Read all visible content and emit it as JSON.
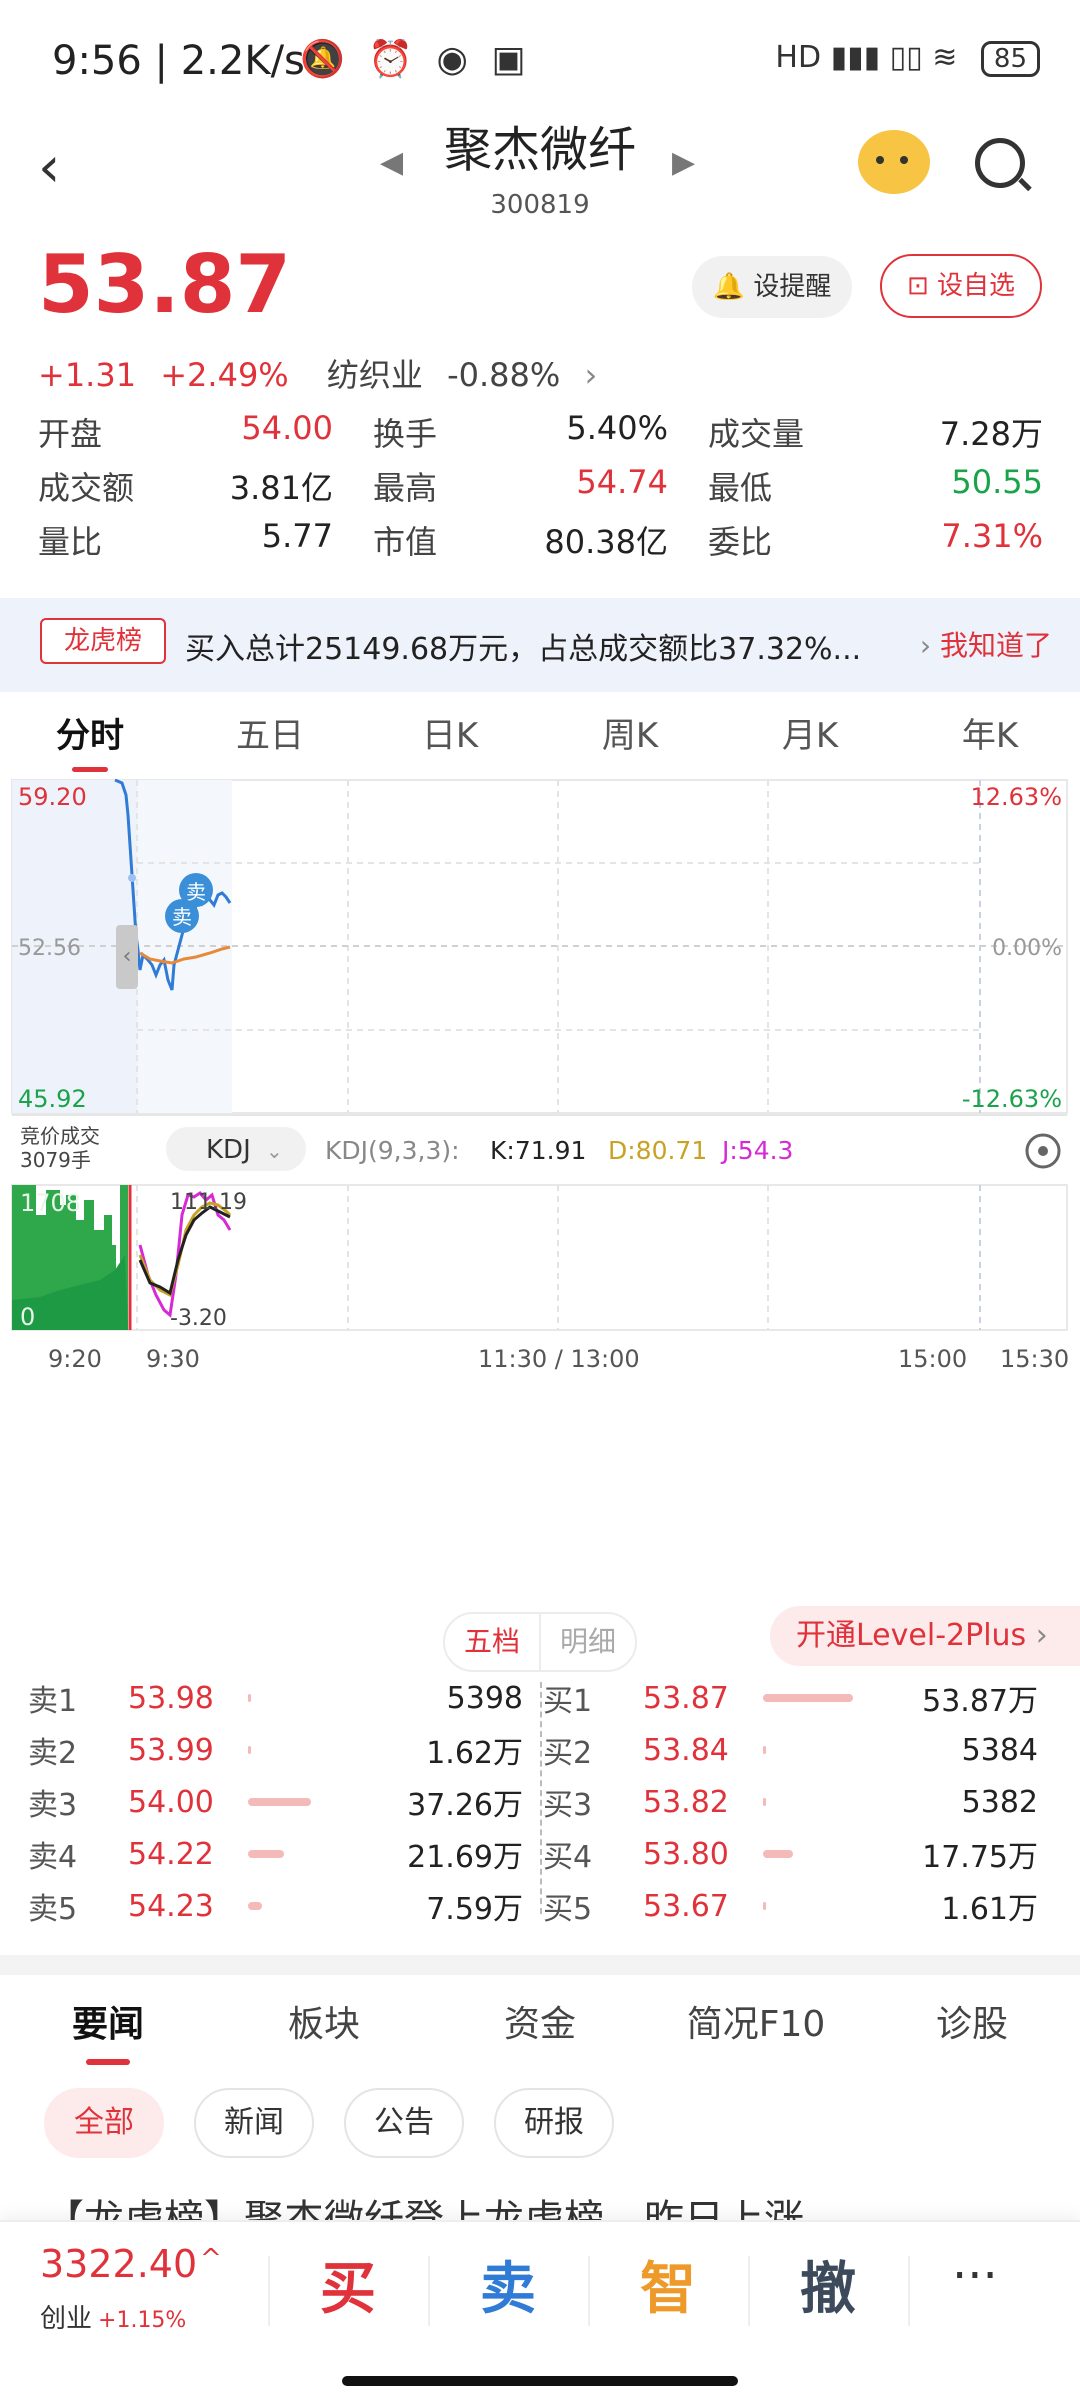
{
  "status_bar": {
    "time": "9:56",
    "speed": "2.2K/s",
    "battery": "85",
    "signal": "HD"
  },
  "header": {
    "title": "聚杰微纤",
    "code": "300819"
  },
  "quote": {
    "price": "53.87",
    "change": "+1.31",
    "change_pct": "+2.49%",
    "industry": "纺织业",
    "industry_change": "-0.88%",
    "remind_label": "设提醒",
    "watch_label": "设自选",
    "stats": [
      [
        {
          "label": "开盘",
          "value": "54.00",
          "color": "red"
        },
        {
          "label": "换手",
          "value": "5.40%",
          "color": "normal"
        },
        {
          "label": "成交量",
          "value": "7.28万",
          "color": "normal"
        }
      ],
      [
        {
          "label": "成交额",
          "value": "3.81亿",
          "color": "normal"
        },
        {
          "label": "最高",
          "value": "54.74",
          "color": "red"
        },
        {
          "label": "最低",
          "value": "50.55",
          "color": "green"
        }
      ],
      [
        {
          "label": "量比",
          "value": "5.77",
          "color": "normal"
        },
        {
          "label": "市值",
          "value": "80.38亿",
          "color": "normal"
        },
        {
          "label": "委比",
          "value": "7.31%",
          "color": "red"
        }
      ]
    ]
  },
  "banner": {
    "tag": "龙虎榜",
    "text": "买入总计25149.68万元，占总成交额比37.32%...",
    "action": "我知道了"
  },
  "chart_tabs": [
    "分时",
    "五日",
    "日K",
    "周K",
    "月K",
    "年K"
  ],
  "chart": {
    "y_max_label": "59.20",
    "y_mid_label": "52.56",
    "y_min_label": "45.92",
    "pct_max_label": "12.63%",
    "pct_mid_label": "0.00%",
    "pct_min_label": "-12.63%",
    "auction_label": "竞价成交",
    "auction_volume": "3079手",
    "indicator_name": "KDJ",
    "indicator_params": "KDJ(9,3,3):",
    "k_label": "K:71.91",
    "d_label": "D:80.71",
    "j_label": "J:54.3",
    "vol_max_label": "1708",
    "vol_min_label": "0",
    "kdj_max_label": "111.19",
    "kdj_min_label": "-3.20",
    "sell_marker": "卖",
    "x_labels": [
      "9:20",
      "9:30",
      "11:30 / 13:00",
      "15:00",
      "15:30"
    ]
  },
  "order_book": {
    "tab_active": "五档",
    "tab_other": "明细",
    "level2_label": "开通Level-2Plus",
    "asks": [
      {
        "label": "卖1",
        "price": "53.98",
        "volume": "5398",
        "bar": 0.02
      },
      {
        "label": "卖2",
        "price": "53.99",
        "volume": "1.62万",
        "bar": 0.04
      },
      {
        "label": "卖3",
        "price": "54.00",
        "volume": "37.26万",
        "bar": 0.7
      },
      {
        "label": "卖4",
        "price": "54.22",
        "volume": "21.69万",
        "bar": 0.4
      },
      {
        "label": "卖5",
        "price": "54.23",
        "volume": "7.59万",
        "bar": 0.15
      }
    ],
    "bids": [
      {
        "label": "买1",
        "price": "53.87",
        "volume": "53.87万",
        "bar": 1.0
      },
      {
        "label": "买2",
        "price": "53.84",
        "volume": "5384",
        "bar": 0.02
      },
      {
        "label": "买3",
        "price": "53.82",
        "volume": "5382",
        "bar": 0.02
      },
      {
        "label": "买4",
        "price": "53.80",
        "volume": "17.75万",
        "bar": 0.33
      },
      {
        "label": "买5",
        "price": "53.67",
        "volume": "1.61万",
        "bar": 0.04
      }
    ]
  },
  "news_tabs": [
    "要闻",
    "板块",
    "资金",
    "简况F10",
    "诊股"
  ],
  "news_filters": [
    "全部",
    "新闻",
    "公告",
    "研报"
  ],
  "news_peek": "【龙虎榜】聚杰微纤登上龙虎榜，昨日上涨",
  "bottom_bar": {
    "index_value": "3322.40",
    "index_name": "创业",
    "index_change": "+1.15%",
    "buy": "买",
    "sell": "卖",
    "smart": "智",
    "cancel": "撤",
    "more": "···"
  }
}
